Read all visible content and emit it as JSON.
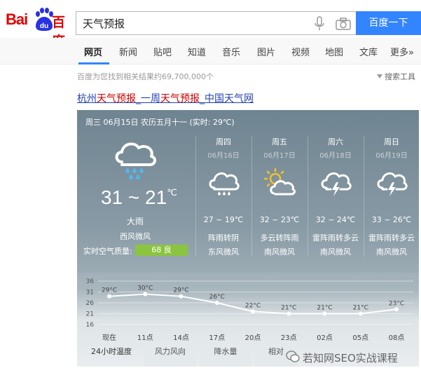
{
  "logo": {
    "bai": "Bai",
    "du_paw": "du",
    "baidu_cn": "百度"
  },
  "search": {
    "query": "天气预报",
    "button": "百度一下"
  },
  "nav": {
    "tabs": [
      "网页",
      "新闻",
      "贴吧",
      "知道",
      "音乐",
      "图片",
      "视频",
      "地图",
      "文库",
      "更多»"
    ],
    "active": "网页"
  },
  "stats": "百度为您找到相关结果约69,700,000个",
  "tools": "搜索工具",
  "result_title": {
    "prefix": "杭州",
    "hl1": "天气预报",
    "mid": "_一周",
    "hl2": "天气预报",
    "suffix": "_中国天气网"
  },
  "weather": {
    "header": "周三 06月15日 农历五月十一 (实时: 29℃)",
    "today": {
      "temp": "31 ~ 21",
      "deg": "℃",
      "condition": "大雨",
      "wind": "西风微风",
      "aqi_label": "实时空气质量:",
      "aqi_value": "68 良",
      "icon": "rain-cloud-icon"
    },
    "days": [
      {
        "weekday": "周四",
        "date": "06月16日",
        "temp": "27 ~ 19℃",
        "condition": "阵雨转阴",
        "wind": "东风微风",
        "icon": "rain-cloud-icon"
      },
      {
        "weekday": "周五",
        "date": "06月17日",
        "temp": "32 ~ 23℃",
        "condition": "多云转阵雨",
        "wind": "南风微风",
        "icon": "sun-cloud-icon"
      },
      {
        "weekday": "周六",
        "date": "06月18日",
        "temp": "32 ~ 24℃",
        "condition": "雷阵雨转多云",
        "wind": "南风微风",
        "icon": "thunder-cloud-icon"
      },
      {
        "weekday": "周日",
        "date": "06月19日",
        "temp": "33 ~ 26℃",
        "condition": "雷阵雨转多云",
        "wind": "南风微风",
        "icon": "thunder-cloud-icon"
      }
    ],
    "chart_tabs": [
      "24小时温度",
      "风力风向",
      "降水量",
      "相对"
    ]
  },
  "chart_data": {
    "type": "line",
    "x": [
      "现在",
      "11点",
      "14点",
      "17点",
      "20点",
      "23点",
      "02点",
      "05点",
      "08点"
    ],
    "series": [
      {
        "values": [
          29,
          30,
          29,
          26,
          22,
          21,
          21,
          21,
          23
        ]
      }
    ],
    "labels": [
      "29°C",
      "30°C",
      "29°C",
      "26°C",
      "22°C",
      "21°C",
      "21°C",
      "21°C",
      "23°C"
    ],
    "yticks": [
      36,
      31,
      26,
      21,
      16
    ],
    "ylim": [
      16,
      36
    ],
    "grid": true
  },
  "watermark": "若知网SEO实战课程",
  "colors": {
    "accent": "#3385ff",
    "logo_red": "#e10602",
    "logo_blue": "#2932e1",
    "aqi_good": "#8bc43f"
  }
}
